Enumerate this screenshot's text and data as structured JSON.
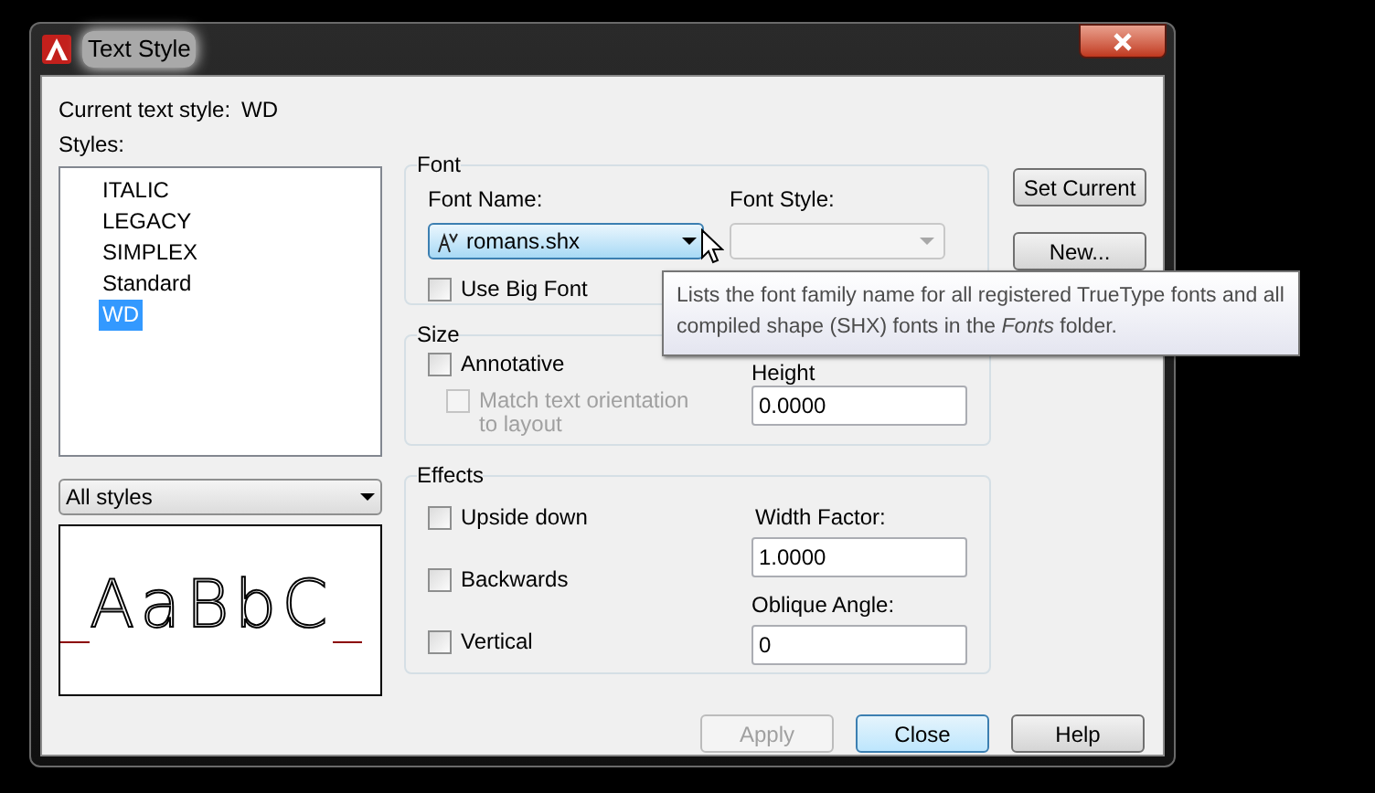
{
  "window": {
    "title": "Text Style"
  },
  "current_style": {
    "label": "Current text style:",
    "value": "WD"
  },
  "styles": {
    "label": "Styles:",
    "items": [
      {
        "name": "ITALIC",
        "selected": false
      },
      {
        "name": "LEGACY",
        "selected": false
      },
      {
        "name": "SIMPLEX",
        "selected": false
      },
      {
        "name": "Standard",
        "selected": false
      },
      {
        "name": "WD",
        "selected": true
      }
    ]
  },
  "filter": {
    "value": "All styles"
  },
  "preview": {
    "text": "AaBbC"
  },
  "font": {
    "title": "Font",
    "font_name": {
      "label": "Font Name:",
      "value": "romans.shx",
      "focused": true
    },
    "use_big_font": {
      "label": "Use Big Font",
      "checked": false
    },
    "font_style": {
      "label": "Font Style:",
      "disabled": true
    }
  },
  "size": {
    "title": "Size",
    "annotative": {
      "label": "Annotative",
      "checked": false
    },
    "match_orientation": {
      "label": "Match text orientation to layout",
      "checked": false,
      "disabled": true
    },
    "height": {
      "label": "Height",
      "value": "0.0000"
    }
  },
  "effects": {
    "title": "Effects",
    "checkboxes": [
      {
        "label": "Upside down",
        "checked": false
      },
      {
        "label": "Backwards",
        "checked": false
      },
      {
        "label": "Vertical",
        "checked": false
      }
    ],
    "width_factor": {
      "label": "Width Factor:",
      "value": "1.0000"
    },
    "oblique_angle": {
      "label": "Oblique Angle:",
      "value": "0"
    }
  },
  "side_buttons": [
    {
      "label": "Set Current"
    },
    {
      "label": "New..."
    }
  ],
  "buttons": [
    {
      "label": "Apply",
      "disabled": true,
      "default": false
    },
    {
      "label": "Close",
      "disabled": false,
      "default": true
    },
    {
      "label": "Help",
      "disabled": false,
      "default": false
    }
  ],
  "tooltip": {
    "text": "Lists the font family name for all registered TrueType fonts and all compiled shape (SHX) fonts in the *Fonts* folder."
  }
}
